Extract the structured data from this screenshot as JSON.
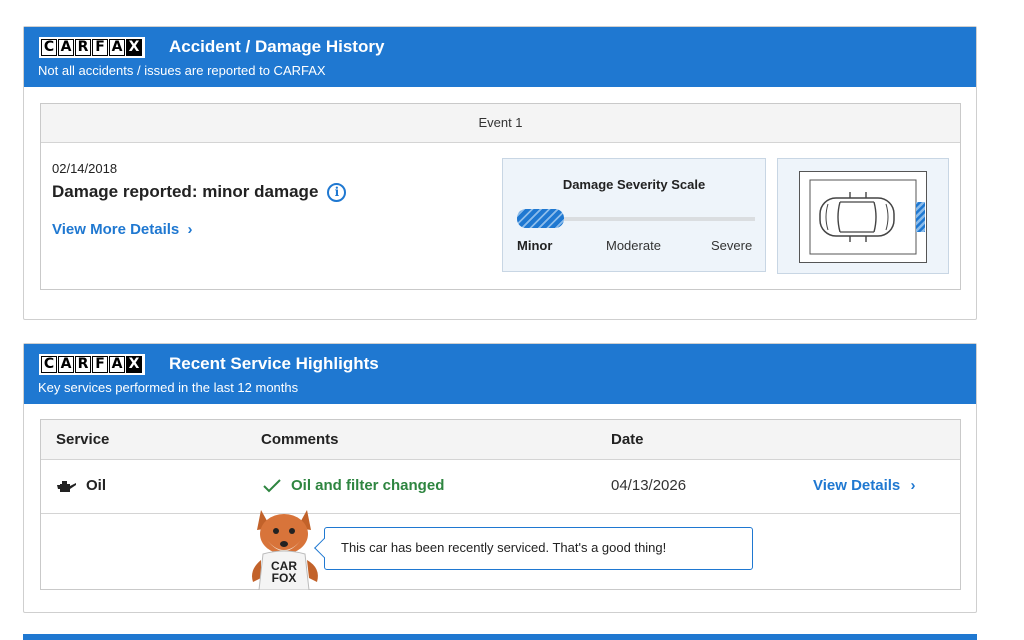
{
  "accident_card": {
    "logo_letters": [
      "C",
      "A",
      "R",
      "F",
      "A",
      "X"
    ],
    "title": "Accident / Damage History",
    "subtitle": "Not all accidents / issues are reported to CARFAX",
    "event": {
      "label": "Event 1",
      "date": "02/14/2018",
      "title": "Damage reported: minor damage",
      "info_icon": "info-icon",
      "details_link": "View More Details",
      "link_chevron": "›",
      "severity": {
        "title": "Damage Severity Scale",
        "labels": [
          "Minor",
          "Moderate",
          "Severe"
        ],
        "level": "Minor",
        "level_fraction": 0.2
      },
      "diagram": {
        "icon": "car-topview-icon",
        "damaged_side": "right"
      }
    }
  },
  "service_card": {
    "logo_letters": [
      "C",
      "A",
      "R",
      "F",
      "A",
      "X"
    ],
    "title": "Recent Service Highlights",
    "subtitle": "Key services performed in the last 12 months",
    "columns": [
      "Service",
      "Comments",
      "Date"
    ],
    "row": {
      "icon": "oil-can-icon",
      "service": "Oil",
      "comment_icon": "checkmark-icon",
      "comment": "Oil and filter changed",
      "date": "04/13/2026",
      "link": "View Details",
      "link_chevron": "›"
    },
    "mascot_text": [
      "CAR",
      "FOX"
    ],
    "message": "This car has been recently serviced. That's a good thing!"
  },
  "colors": {
    "brand_blue": "#1f78d1",
    "success_green": "#2e8540",
    "panel_bg": "#eef4fa"
  }
}
